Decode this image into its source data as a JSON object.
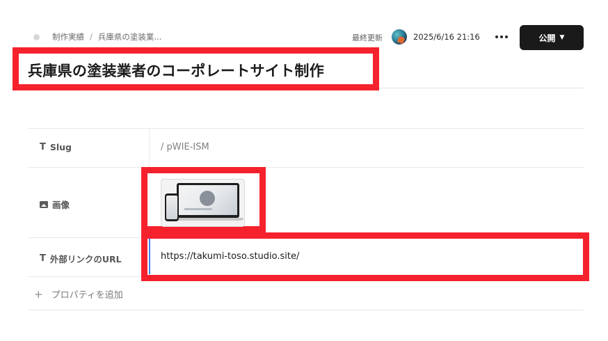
{
  "breadcrumb": {
    "parent": "制作実績",
    "separator": "/",
    "current": "兵庫県の塗装業..."
  },
  "meta": {
    "updated_label": "最終更新",
    "updated_time": "2025/6/16 21:16"
  },
  "actions": {
    "publish_label": "公開",
    "publish_icon": "chevron-down-icon",
    "more_icon": "more-horizontal-icon"
  },
  "page": {
    "title": "兵庫県の塗装業者のコーポレートサイト制作"
  },
  "properties": [
    {
      "type_icon": "T",
      "label": "Slug",
      "value": "/ pWIE-ISM"
    },
    {
      "type_icon": "image-icon",
      "label": "画像",
      "value": ""
    },
    {
      "type_icon": "T",
      "label": "外部リンクのURL",
      "value": "https://takumi-toso.studio.site/"
    }
  ],
  "add_property": {
    "icon": "+",
    "label": "プロパティを追加"
  },
  "colors": {
    "highlight": "#f5222d",
    "publish_bg": "#1a1a1a",
    "focus_accent": "#3b82f6"
  }
}
